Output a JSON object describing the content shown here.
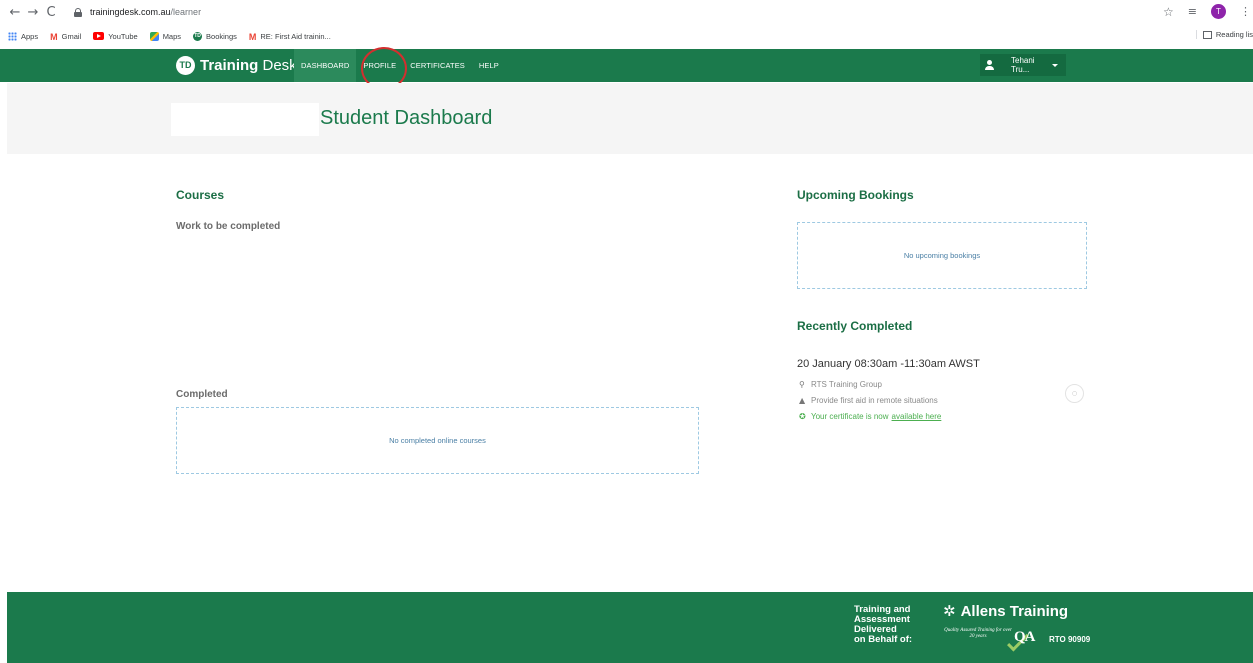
{
  "browser": {
    "nav": {
      "back": "←",
      "forward": "→",
      "reload": "C"
    },
    "url_domain": "trainingdesk.com.au",
    "url_path": "/learner",
    "avatar_letter": "T",
    "bookmarks": [
      {
        "label": "Apps",
        "icon": "apps-icon"
      },
      {
        "label": "Gmail",
        "icon": "gmail-icon"
      },
      {
        "label": "YouTube",
        "icon": "youtube-icon"
      },
      {
        "label": "Maps",
        "icon": "maps-icon"
      },
      {
        "label": "Bookings",
        "icon": "trainingdesk-icon"
      },
      {
        "label": "RE: First Aid trainin...",
        "icon": "gmail-icon"
      }
    ],
    "reading_list": "Reading lis"
  },
  "header": {
    "logo_mark": "TD",
    "logo_bold": "Training",
    "logo_light": " Desk",
    "nav": [
      {
        "label": "DASHBOARD",
        "active": true
      },
      {
        "label": "PROFILE",
        "active": false
      },
      {
        "label": "CERTIFICATES",
        "active": false
      },
      {
        "label": "HELP",
        "active": false
      }
    ],
    "user_name": "Tehani Tru..."
  },
  "page_title": "Student Dashboard",
  "courses": {
    "heading": "Courses",
    "work_heading": "Work to be completed",
    "completed_heading": "Completed",
    "completed_empty": "No completed online courses"
  },
  "bookings": {
    "heading": "Upcoming Bookings",
    "empty": "No upcoming bookings"
  },
  "recent": {
    "heading": "Recently Completed",
    "title": "20 January 08:30am -11:30am AWST",
    "location": "RTS Training Group",
    "course": "Provide first aid in remote situations",
    "cert_text": "Your certificate is now",
    "cert_link": "available here"
  },
  "footer": {
    "delivered": "Training and\nAssessment\nDelivered\non Behalf of:",
    "brand": "Allens Training",
    "qa_text": "Quality Assured Training for over 20 years",
    "qa_mark": "QA",
    "rto": "RTO 90909"
  },
  "colors": {
    "brand_green": "#1b7a4c",
    "active_nav": "#2c8a5c",
    "highlight_circle": "#d32f2f",
    "cert_green": "#4caf50"
  }
}
